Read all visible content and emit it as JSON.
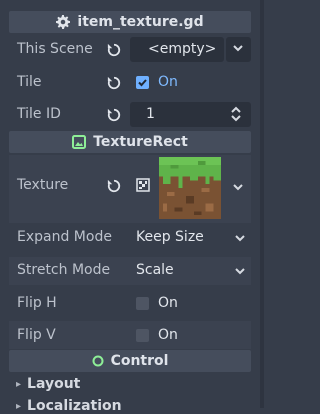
{
  "script_section": {
    "title": "item_texture.gd",
    "icon": "gear-icon"
  },
  "properties": {
    "this_scene": {
      "label": "This Scene",
      "value": "<empty>"
    },
    "tile": {
      "label": "Tile",
      "checked": true,
      "value": "On"
    },
    "tile_id": {
      "label": "Tile ID",
      "value": "1"
    }
  },
  "texture_rect_section": {
    "title": "TextureRect",
    "icon": "image-icon"
  },
  "texture_props": {
    "texture": {
      "label": "Texture"
    },
    "expand_mode": {
      "label": "Expand Mode",
      "value": "Keep Size"
    },
    "stretch_mode": {
      "label": "Stretch Mode",
      "value": "Scale"
    },
    "flip_h": {
      "label": "Flip H",
      "checked": false,
      "value": "On"
    },
    "flip_v": {
      "label": "Flip V",
      "checked": false,
      "value": "On"
    }
  },
  "control_section": {
    "title": "Control",
    "icon": "circle-icon"
  },
  "subsections": {
    "layout": "Layout",
    "localization": "Localization"
  },
  "colors": {
    "accent": "#6fb0ff",
    "control_green": "#8eef97",
    "texture_green": "#5fcf6f"
  }
}
